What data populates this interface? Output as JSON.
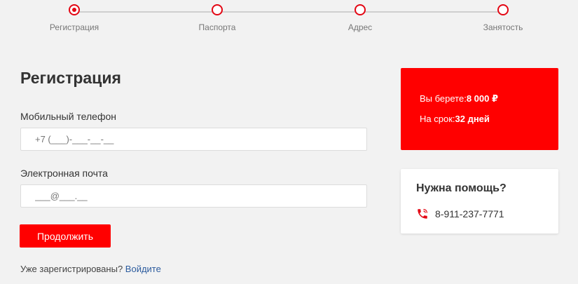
{
  "stepper": {
    "steps": [
      {
        "label": "Регистрация",
        "active": true
      },
      {
        "label": "Паспорта",
        "active": false
      },
      {
        "label": "Адрес",
        "active": false
      },
      {
        "label": "Занятость",
        "active": false
      }
    ]
  },
  "form": {
    "title": "Регистрация",
    "phone_label": "Мобильный телефон",
    "phone_placeholder": "+7 (___)-___-__-__",
    "email_label": "Электронная почта",
    "email_placeholder": "___@___.__",
    "continue_label": "Продолжить",
    "login_prompt": "Уже зарегистрированы?",
    "login_link": "Войдите"
  },
  "summary": {
    "amount_label": "Вы берете:",
    "amount_value": "8 000 ₽",
    "term_label": "На срок:",
    "term_value": "32 дней"
  },
  "help": {
    "title": "Нужна помощь?",
    "phone": "8-911-237-7771",
    "icon": "phone-icon"
  },
  "colors": {
    "accent": "#ff0000",
    "link": "#2d5c9e",
    "background": "#f2f2f2"
  }
}
